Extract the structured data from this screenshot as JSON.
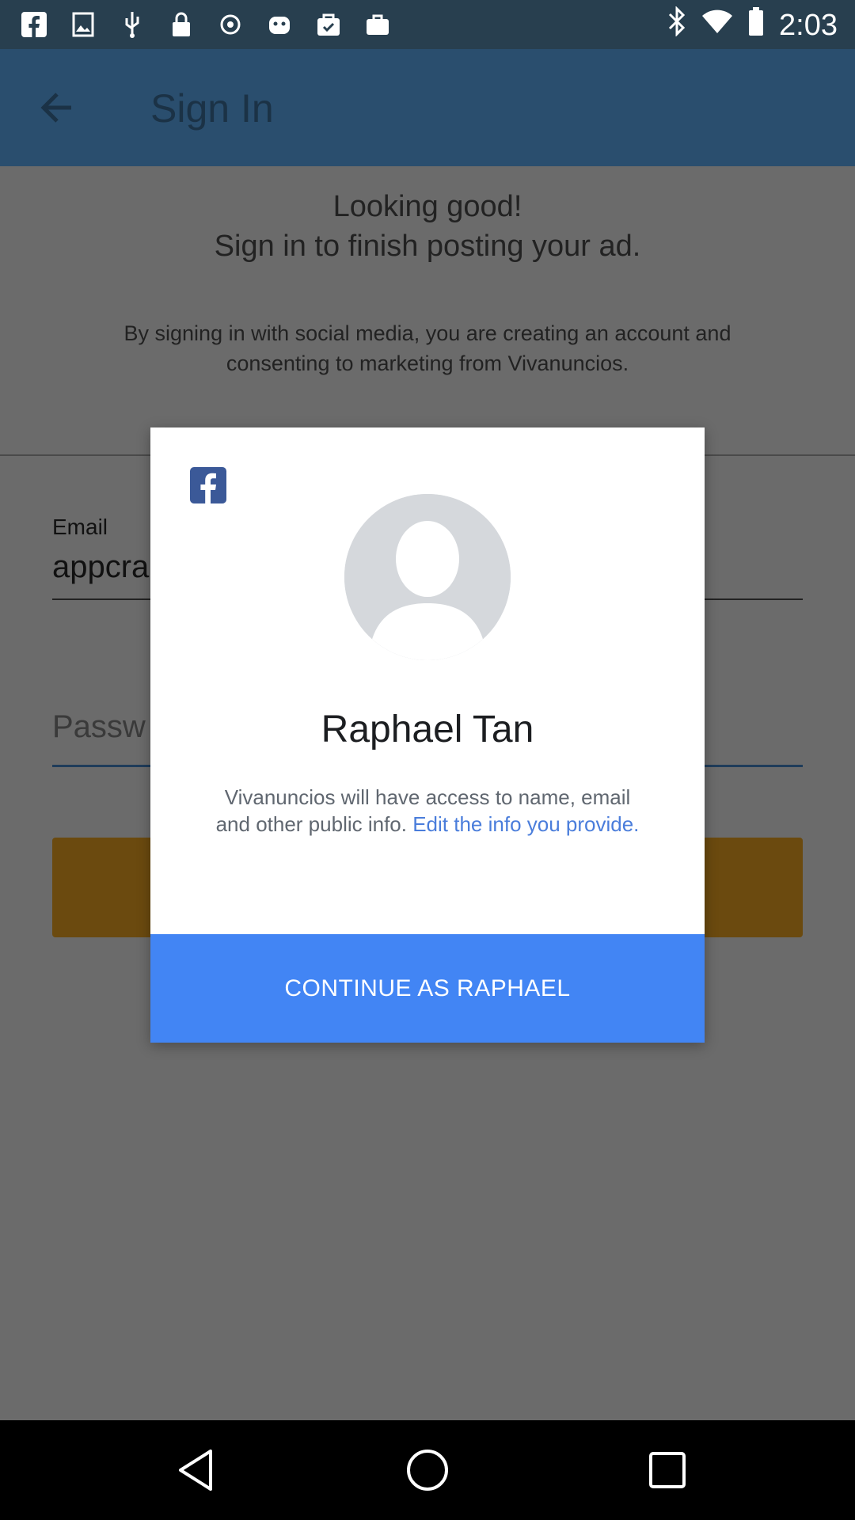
{
  "status_bar": {
    "time": "2:03",
    "left_icons": [
      "facebook-icon",
      "image-icon",
      "usb-icon",
      "lock-icon",
      "circle-icon",
      "android-icon",
      "check-bag-icon",
      "briefcase-icon"
    ],
    "right_icons": [
      "bluetooth-icon",
      "wifi-icon",
      "battery-icon"
    ]
  },
  "app_bar": {
    "title": "Sign In"
  },
  "page": {
    "headline_line1": "Looking good!",
    "headline_line2": "Sign in to finish posting your ad.",
    "consent_text": "By signing in with social media, you are creating an account and consenting to marketing from Vivanuncios.",
    "email_label": "Email",
    "email_value": "appcra",
    "password_placeholder": "Passw"
  },
  "dialog": {
    "user_name": "Raphael Tan",
    "access_text": "Vivanuncios will have access to name, email and other public info.",
    "access_link": "Edit the info you provide.",
    "continue_label": "CONTINUE AS RAPHAEL"
  },
  "colors": {
    "primary_button": "#4285f4",
    "link": "#4a7ddb",
    "facebook": "#3b5998"
  }
}
